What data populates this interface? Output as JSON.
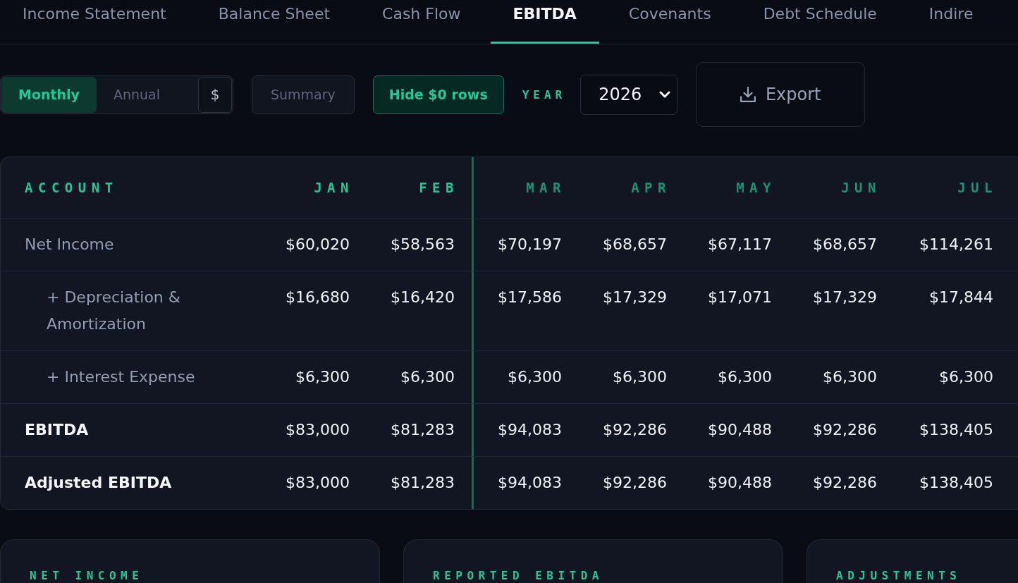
{
  "tabs": [
    {
      "label": "Income Statement",
      "selected": false
    },
    {
      "label": "Balance Sheet",
      "selected": false
    },
    {
      "label": "Cash Flow",
      "selected": false
    },
    {
      "label": "EBITDA",
      "selected": true
    },
    {
      "label": "Covenants",
      "selected": false
    },
    {
      "label": "Debt Schedule",
      "selected": false
    },
    {
      "label": "Indire",
      "selected": false
    }
  ],
  "toolbar": {
    "view_modes": [
      {
        "label": "Monthly",
        "selected": true
      },
      {
        "label": "Annual",
        "selected": false
      }
    ],
    "currency_button": "$",
    "toggles": [
      {
        "label": "Summary",
        "on": false
      },
      {
        "label": "Hide $0 rows",
        "on": true
      }
    ],
    "year": {
      "label": "YEAR",
      "value": "2026"
    },
    "export_button": "Export"
  },
  "table": {
    "columns": [
      {
        "label": "ACCOUNT",
        "kind": "account"
      },
      {
        "label": "JAN",
        "kind": "actual"
      },
      {
        "label": "FEB",
        "kind": "actual"
      },
      {
        "label": "MAR",
        "kind": "forecast"
      },
      {
        "label": "APR",
        "kind": "forecast"
      },
      {
        "label": "MAY",
        "kind": "forecast"
      },
      {
        "label": "JUN",
        "kind": "forecast"
      },
      {
        "label": "JUL",
        "kind": "forecast"
      }
    ],
    "rows": [
      {
        "label": "Net Income",
        "kind": "base",
        "values": [
          "$60,020",
          "$58,563",
          "$70,197",
          "$68,657",
          "$67,117",
          "$68,657",
          "$114,261"
        ]
      },
      {
        "label": "+ Depreciation & Amortization",
        "kind": "addback",
        "values": [
          "$16,680",
          "$16,420",
          "$17,586",
          "$17,329",
          "$17,071",
          "$17,329",
          "$17,844"
        ]
      },
      {
        "label": "+ Interest Expense",
        "kind": "addback",
        "values": [
          "$6,300",
          "$6,300",
          "$6,300",
          "$6,300",
          "$6,300",
          "$6,300",
          "$6,300"
        ]
      },
      {
        "label": "EBITDA",
        "kind": "total",
        "values": [
          "$83,000",
          "$81,283",
          "$94,083",
          "$92,286",
          "$90,488",
          "$92,286",
          "$138,405"
        ]
      },
      {
        "label": "Adjusted EBITDA",
        "kind": "total",
        "values": [
          "$83,000",
          "$81,283",
          "$94,083",
          "$92,286",
          "$90,488",
          "$92,286",
          "$138,405"
        ]
      }
    ]
  },
  "summary_cards": [
    {
      "title": "NET INCOME"
    },
    {
      "title": "REPORTED EBITDA"
    },
    {
      "title": "ADJUSTMENTS"
    }
  ]
}
